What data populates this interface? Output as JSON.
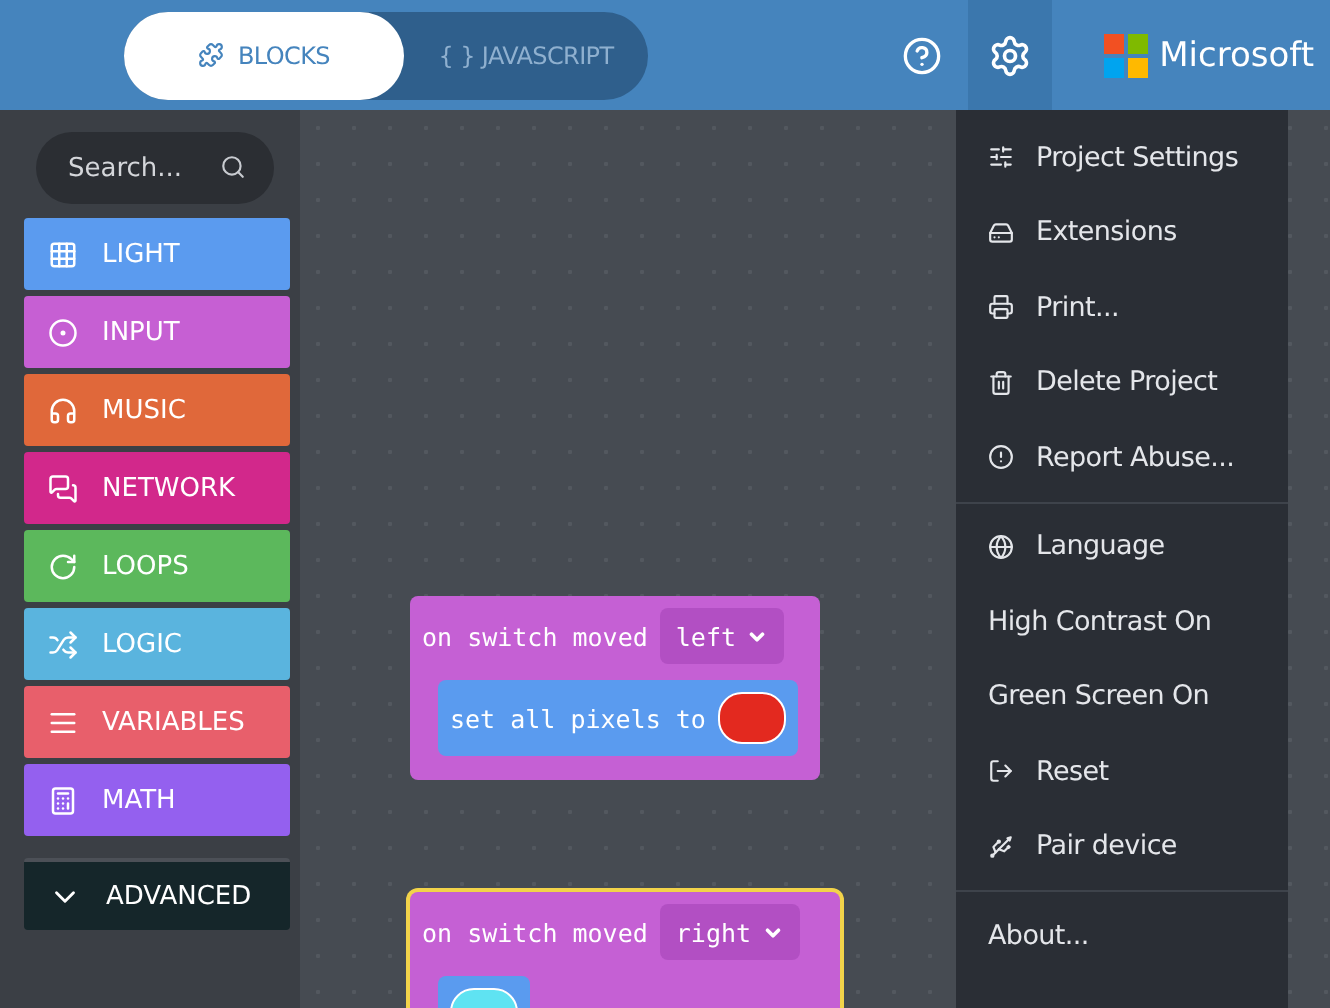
{
  "header": {
    "tabs": [
      {
        "label": "BLOCKS",
        "selected": true
      },
      {
        "label": "{ } JAVASCRIPT",
        "selected": false
      }
    ],
    "brand": "Microsoft"
  },
  "toolbox": {
    "search": {
      "placeholder": "Search..."
    },
    "categories": [
      {
        "label": "LIGHT",
        "color": "#5b9bef"
      },
      {
        "label": "INPUT",
        "color": "#c65fd3"
      },
      {
        "label": "MUSIC",
        "color": "#e0683a"
      },
      {
        "label": "NETWORK",
        "color": "#d2288b"
      },
      {
        "label": "LOOPS",
        "color": "#5cb85c"
      },
      {
        "label": "LOGIC",
        "color": "#5ab4de"
      },
      {
        "label": "VARIABLES",
        "color": "#e85f6b"
      },
      {
        "label": "MATH",
        "color": "#9460ef"
      }
    ],
    "advanced": {
      "label": "ADVANCED",
      "expanded": false
    }
  },
  "workspace": {
    "blocks": [
      {
        "event": "on switch moved",
        "option": "left",
        "highlighted": false,
        "statement": "set all pixels to",
        "color": "#e3291f"
      },
      {
        "event": "on switch moved",
        "option": "right",
        "highlighted": true,
        "color": "#5fe3f2"
      }
    ]
  },
  "menu": {
    "groups": [
      [
        {
          "label": "Project Settings",
          "kind": "icon"
        },
        {
          "label": "Extensions",
          "kind": "icon"
        },
        {
          "label": "Print...",
          "kind": "icon"
        },
        {
          "label": "Delete Project",
          "kind": "icon"
        },
        {
          "label": "Report Abuse...",
          "kind": "icon"
        }
      ],
      [
        {
          "label": "Language",
          "kind": "icon"
        },
        {
          "label": "High Contrast On",
          "kind": "text"
        },
        {
          "label": "Green Screen On",
          "kind": "text"
        },
        {
          "label": "Reset",
          "kind": "icon"
        },
        {
          "label": "Pair device",
          "kind": "icon"
        }
      ],
      [
        {
          "label": "About...",
          "kind": "text"
        }
      ]
    ]
  }
}
